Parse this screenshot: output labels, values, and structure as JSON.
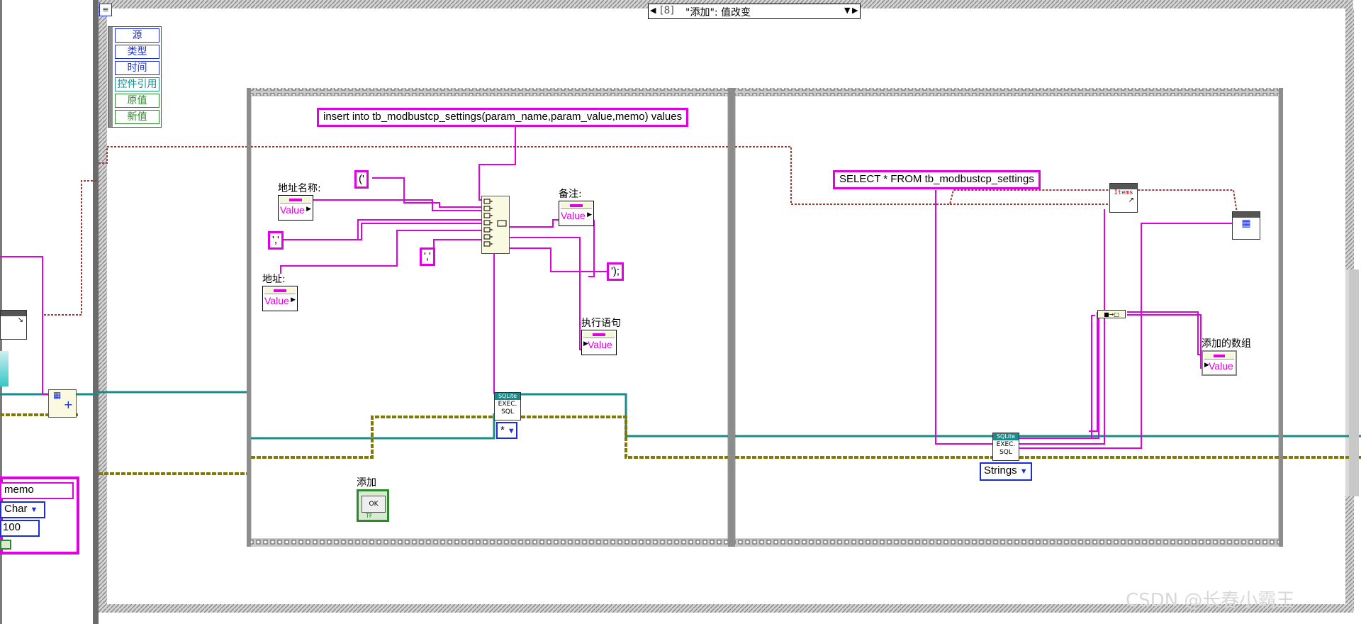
{
  "event_selector": {
    "index": "[8]",
    "label": "\"添加\": 值改变"
  },
  "event_data_node": {
    "items": [
      "源",
      "类型",
      "时间",
      "控件引用",
      "原值",
      "新值"
    ]
  },
  "case_left": {
    "sql_insert": "insert into tb_modbustcp_settings(param_name,param_value,memo) values",
    "const_open": "('",
    "const_sep1": "','",
    "const_sep2": "','",
    "const_close": "');",
    "label_addr_name": "地址名称:",
    "label_addr": "地址:",
    "label_memo": "备注:",
    "label_exec_stmt": "执行语句",
    "value_text": "Value",
    "sqlite_badge": "SQLite",
    "exec_sql_line1": "EXEC.",
    "exec_sql_line2": "SQL",
    "star_enum": "*",
    "button_label": "添加",
    "ok_text": "OK",
    "tf_text": "TF"
  },
  "case_right": {
    "sql_select": "SELECT * FROM tb_modbustcp_settings",
    "sqlite_badge": "SQLite",
    "exec_sql_line1": "EXEC.",
    "exec_sql_line2": "SQL",
    "strings_enum": "Strings",
    "items_text": "Items",
    "label_added_array": "添加的数组",
    "value_text": "Value"
  },
  "outside_left": {
    "memo_text": "memo",
    "char_enum": "Char",
    "num_100": "100"
  },
  "watermark": "CSDN @长春小霸王",
  "colors": {
    "pink_wire": "#e000e0",
    "teal_wire": "#1a8a8a",
    "olive_wire": "#807a00",
    "frame_gray": "#8c8c8c"
  }
}
